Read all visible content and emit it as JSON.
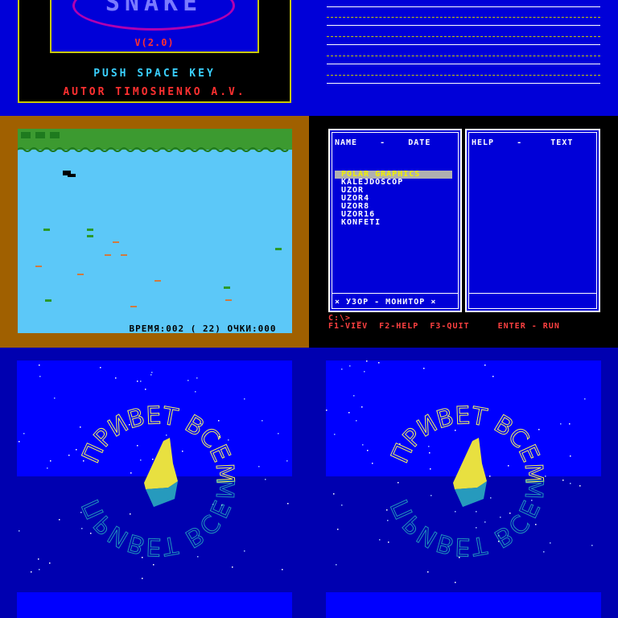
{
  "colors": {
    "blue": "#0000d8",
    "yellow": "#c8c800",
    "red": "#ff3030",
    "cyan": "#3ad0ff"
  },
  "snake": {
    "logo": "SNAKE",
    "version": "V(2.0)",
    "push": "PUSH SPACE KEY",
    "author": "AUTOR TIMOSHENKO A.V."
  },
  "game": {
    "status": "ВРЕМЯ:002 ( 22) ОЧКИ:000"
  },
  "filemanager": {
    "left_header": "NAME    -    DATE",
    "right_header": "HELP    -     TEXT",
    "files": [
      "POLAR GRAPHICS",
      "KALEJDOSCOP",
      "UZOR",
      "UZOR4",
      "UZOR8",
      "UZOR16",
      "KONFETI"
    ],
    "selected_index": 0,
    "footer": "× УЗОР - МОНИТОР ×",
    "prompt": "C:\\> _",
    "keys": "F1-VIEV  F2-HELP  F3-QUIT     ENTER - RUN"
  },
  "greeting": {
    "text": "ПРИВЕТ ВСЕМ"
  }
}
